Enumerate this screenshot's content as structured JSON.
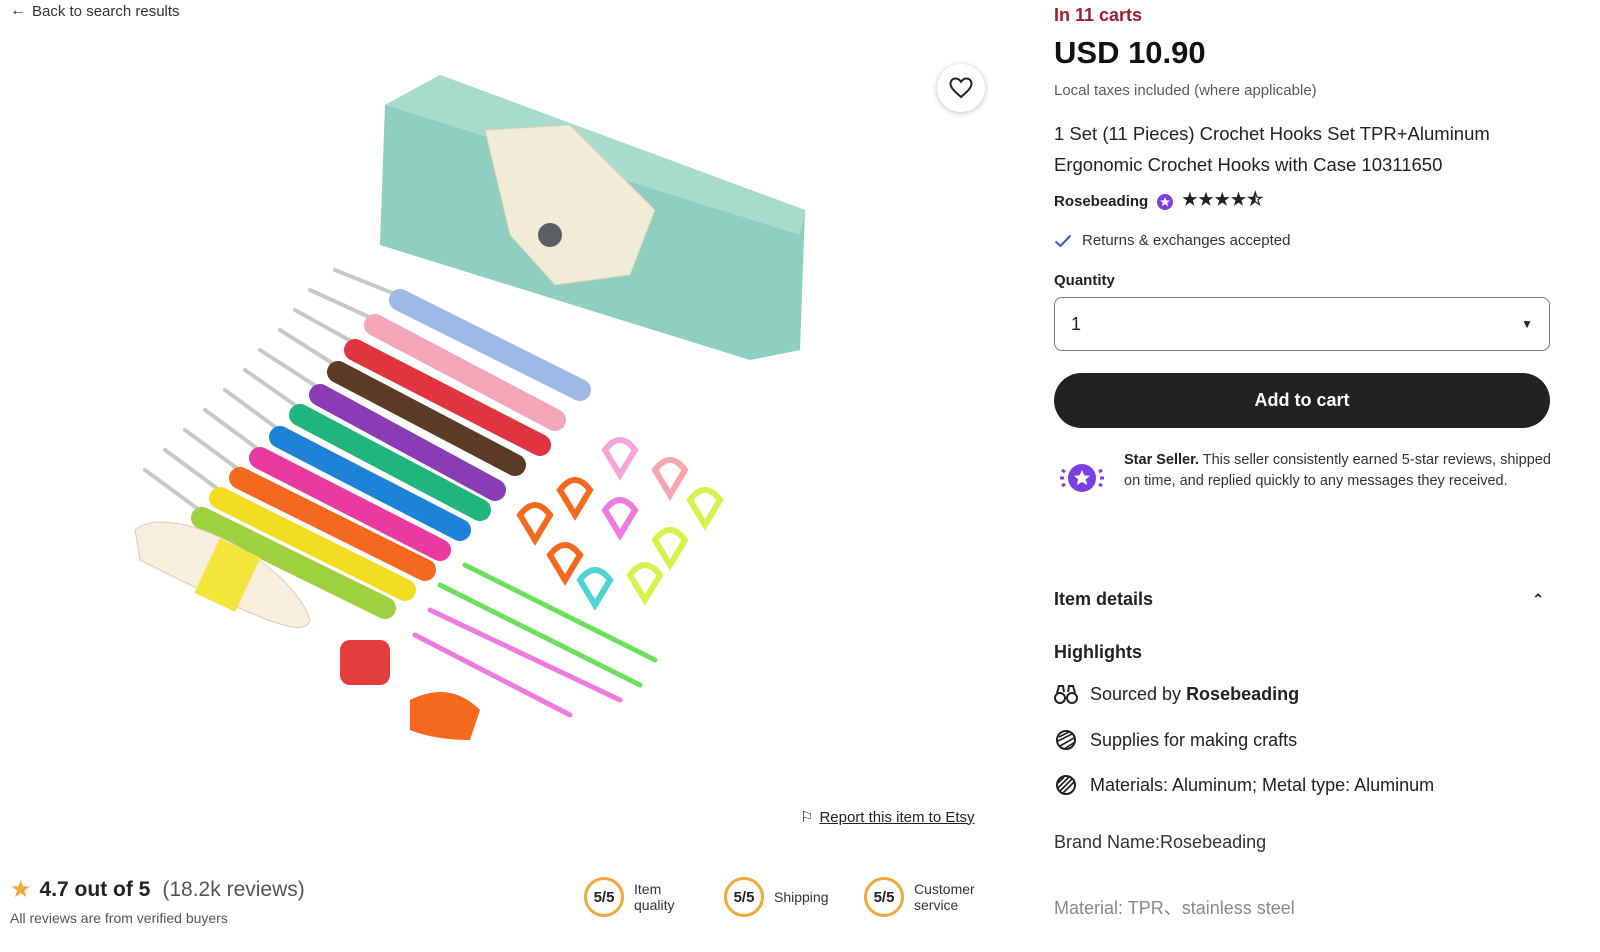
{
  "nav": {
    "back_label": "Back to search results"
  },
  "listing": {
    "in_carts": "In 11 carts",
    "price": "USD 10.90",
    "taxes_note": "Local taxes included (where applicable)",
    "title": "1 Set (11 Pieces) Crochet Hooks Set TPR+Aluminum Ergonomic Crochet Hooks with Case 10311650",
    "shop_name": "Rosebeading",
    "shop_stars": "★★★★⯪",
    "returns": "Returns & exchanges accepted"
  },
  "quantity": {
    "label": "Quantity",
    "value": "1"
  },
  "cart": {
    "button_label": "Add to cart"
  },
  "star_seller": {
    "title": "Star Seller.",
    "text": " This seller consistently earned 5-star reviews, shipped on time, and replied quickly to any messages they received."
  },
  "details": {
    "header": "Item details",
    "highlights_title": "Highlights",
    "sourced_prefix": "Sourced by ",
    "sourced_shop": "Rosebeading",
    "supplies": "Supplies for making crafts",
    "materials": "Materials: Aluminum; Metal type: Aluminum",
    "brand": "Brand Name:Rosebeading",
    "material_desc": "Material: TPR、stainless steel"
  },
  "report": {
    "label": "Report this item to Etsy"
  },
  "reviews": {
    "rating": "4.7 out of 5",
    "count": "(18.2k reviews)",
    "verified": "All reviews are from verified buyers",
    "scores": [
      {
        "value": "5/5",
        "label_line1": "Item",
        "label_line2": "quality"
      },
      {
        "value": "5/5",
        "label_line1": "Shipping",
        "label_line2": ""
      },
      {
        "value": "5/5",
        "label_line1": "Customer",
        "label_line2": "service"
      }
    ]
  },
  "colors": {
    "accent_red": "#a61a2e",
    "button_dark": "#222222",
    "rating_ring": "#f2a93b",
    "star_seller_purple": "#7b3fe4"
  }
}
